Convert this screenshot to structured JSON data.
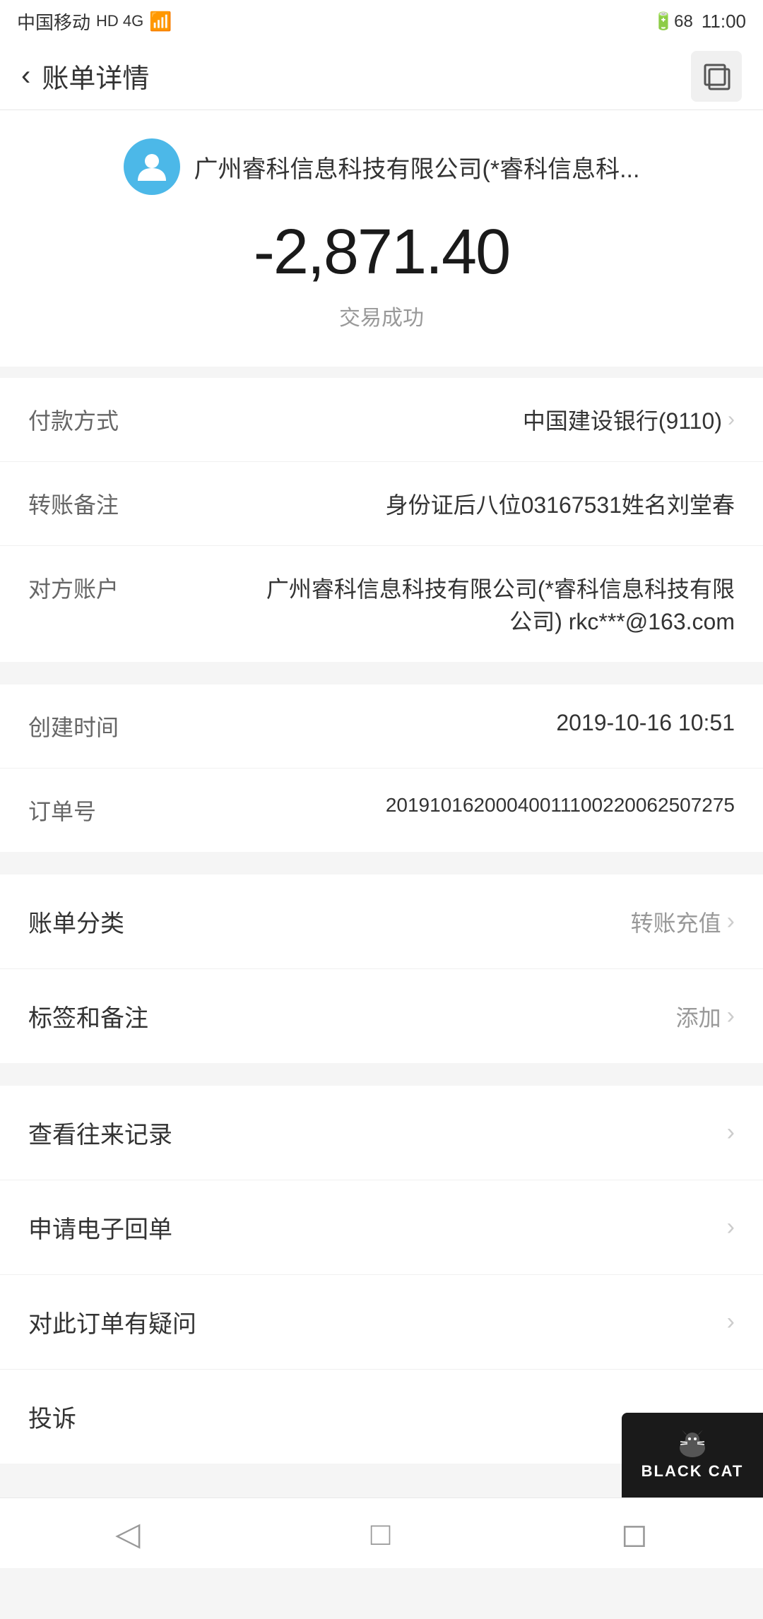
{
  "statusBar": {
    "carrier": "中国移动",
    "networkType": "HD 4G",
    "battery": "68",
    "time": "11:00"
  },
  "header": {
    "backLabel": "‹",
    "title": "账单详情",
    "windowIcon": "⧉"
  },
  "merchant": {
    "name": "广州睿科信息科技有限公司(*睿科信息科...",
    "amount": "-2,871.40",
    "status": "交易成功"
  },
  "details": {
    "paymentMethod": {
      "label": "付款方式",
      "value": "中国建设银行(9110)"
    },
    "transferNote": {
      "label": "转账备注",
      "value": "身份证后八位03167531姓名刘堂春"
    },
    "counterparty": {
      "label": "对方账户",
      "value1": "广州睿科信息科技有限公司(*睿科信息科技有限",
      "value2": "公司) rkc***@163.com"
    },
    "createTime": {
      "label": "创建时间",
      "value": "2019-10-16 10:51"
    },
    "orderNo": {
      "label": "订单号",
      "value": "20191016200040011100220062507275"
    }
  },
  "classification": {
    "category": {
      "label": "账单分类",
      "value": "转账充值"
    },
    "tags": {
      "label": "标签和备注",
      "value": "添加"
    }
  },
  "actions": {
    "viewHistory": "查看往来记录",
    "requestReceipt": "申请电子回单",
    "questionOrder": "对此订单有疑问",
    "complain": "投诉"
  },
  "bottomNav": {
    "back": "◁",
    "home": "□",
    "recent": "◻"
  },
  "watermark": {
    "text": "BLACK CAT"
  }
}
